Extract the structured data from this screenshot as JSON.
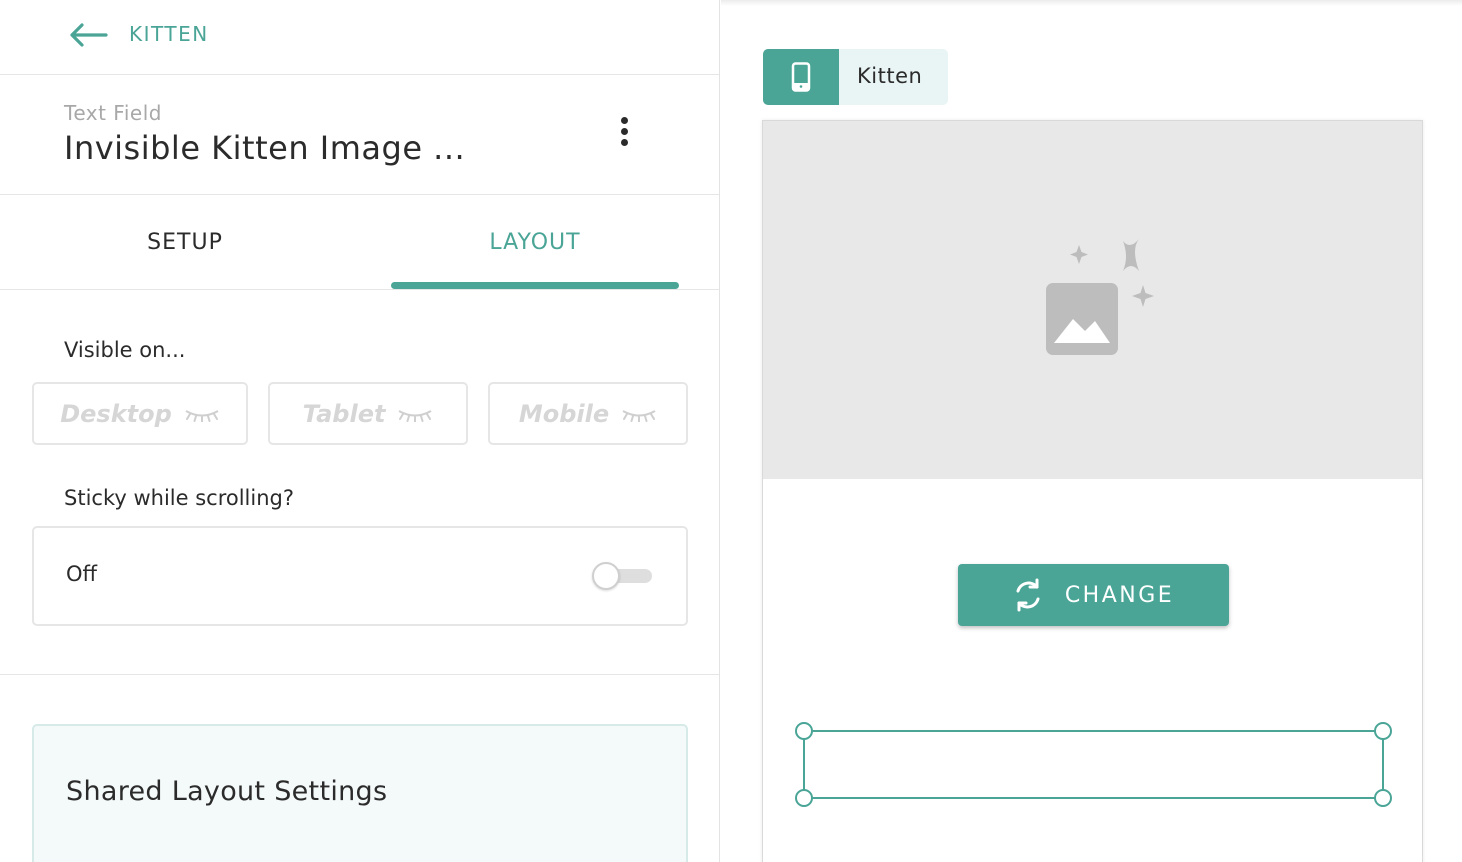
{
  "colors": {
    "accent": "#4aa597",
    "text": "#2b2b2b",
    "muted": "#a8a8a8",
    "disabled": "#d6d6d6",
    "placeholder_bg": "#e8e8e8"
  },
  "nav": {
    "back_label": "KITTEN",
    "back_icon": "arrow-left-icon"
  },
  "element": {
    "type": "Text Field",
    "title": "Invisible Kitten Image ...",
    "menu_icon": "more-vertical-icon"
  },
  "tabs": [
    {
      "label": "SETUP",
      "active": false
    },
    {
      "label": "LAYOUT",
      "active": true
    }
  ],
  "visibility": {
    "label": "Visible on...",
    "options": [
      {
        "label": "Desktop",
        "icon": "eye-closed-icon"
      },
      {
        "label": "Tablet",
        "icon": "eye-closed-icon"
      },
      {
        "label": "Mobile",
        "icon": "eye-closed-icon"
      }
    ]
  },
  "sticky": {
    "label": "Sticky while scrolling?",
    "value": "Off",
    "enabled": false
  },
  "shared_layout": {
    "title": "Shared Layout Settings"
  },
  "preview": {
    "device_icon": "mobile-phone-icon",
    "device_name": "Kitten",
    "image_icon": "image-sparkles-icon",
    "change_button": "CHANGE",
    "change_icon": "refresh-icon"
  }
}
